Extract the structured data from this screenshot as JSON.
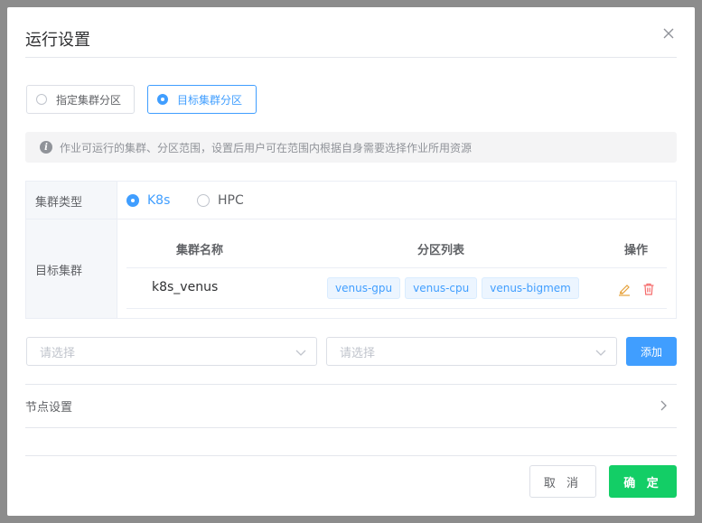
{
  "dialog": {
    "title": "运行设置"
  },
  "scope": {
    "options": [
      {
        "label": "指定集群分区",
        "selected": false
      },
      {
        "label": "目标集群分区",
        "selected": true
      }
    ]
  },
  "info": {
    "text": "作业可运行的集群、分区范围，设置后用户可在范围内根据自身需要选择作业所用资源"
  },
  "cluster_type": {
    "label": "集群类型",
    "options": [
      {
        "label": "K8s",
        "selected": true
      },
      {
        "label": "HPC",
        "selected": false
      }
    ]
  },
  "target_cluster": {
    "label": "目标集群",
    "headers": {
      "name": "集群名称",
      "partitions": "分区列表",
      "actions": "操作"
    },
    "rows": [
      {
        "name": "k8s_venus",
        "partitions": [
          "venus-gpu",
          "venus-cpu",
          "venus-bigmem"
        ]
      }
    ]
  },
  "selects": [
    {
      "placeholder": "请选择"
    },
    {
      "placeholder": "请选择"
    }
  ],
  "add_button": "添加",
  "node_settings": {
    "label": "节点设置"
  },
  "footer": {
    "cancel": "取 消",
    "confirm": "确 定"
  },
  "colors": {
    "primary": "#409eff",
    "success": "#13ce66",
    "edit_icon": "#e6a23c",
    "delete_icon": "#f56c6c"
  }
}
